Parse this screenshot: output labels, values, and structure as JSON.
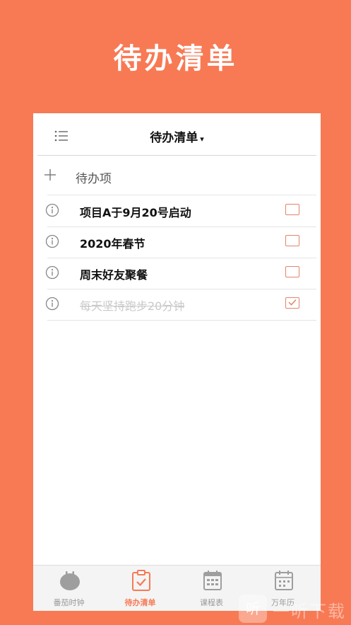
{
  "hero": {
    "title": "待办清单"
  },
  "nav": {
    "title": "待办清单",
    "caret": "▾"
  },
  "add": {
    "label": "待办项"
  },
  "todos": [
    {
      "text": "项目A于9月20号启动",
      "done": false
    },
    {
      "text": "2020年春节",
      "done": false
    },
    {
      "text": "周末好友聚餐",
      "done": false
    },
    {
      "text": "每天坚持跑步20分钟",
      "done": true
    }
  ],
  "tabs": [
    {
      "label": "番茄时钟",
      "icon": "tomato-icon",
      "active": false
    },
    {
      "label": "待办清单",
      "icon": "clipboard-check-icon",
      "active": true
    },
    {
      "label": "课程表",
      "icon": "calendar-grid-icon",
      "active": false
    },
    {
      "label": "万年历",
      "icon": "calendar-icon",
      "active": false
    }
  ],
  "watermark": {
    "glyph": "听",
    "text": "一听下载"
  },
  "colors": {
    "accent": "#F77A55",
    "checkbox": "#E2846A",
    "muted": "#999999"
  }
}
